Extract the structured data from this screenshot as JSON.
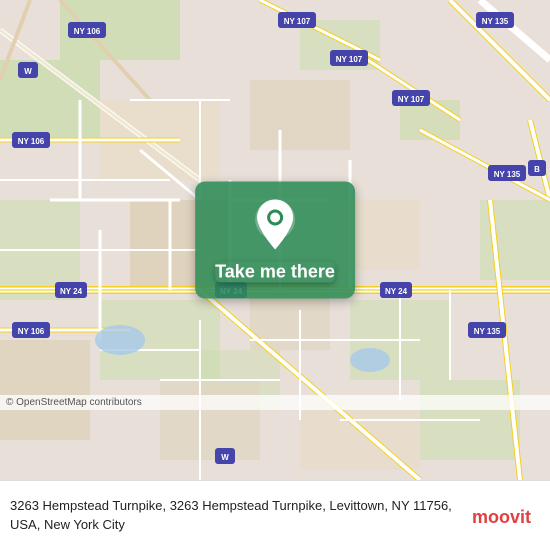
{
  "map": {
    "background_color": "#e8e0d8",
    "copyright": "© OpenStreetMap contributors",
    "location_pin_color": "#2e8b57",
    "roads": {
      "highway_color": "#f5d020",
      "street_color": "#ffffff",
      "major_road_color": "#ffd966"
    }
  },
  "button": {
    "label": "Take me there",
    "background_color": "#2e8b57",
    "text_color": "#ffffff"
  },
  "info_bar": {
    "address": "3263 Hempstead Turnpike, 3263 Hempstead Turnpike, Levittown, NY 11756, USA, New York City",
    "logo_text": "moovit",
    "logo_color": "#e04040"
  },
  "route_badges": [
    "NY 106",
    "NY 106",
    "NY 106",
    "NY 107",
    "NY 107",
    "NY 107",
    "NY 135",
    "NY 135",
    "NY 135",
    "NY 24",
    "NY 24",
    "NY 24",
    "W",
    "W",
    "B"
  ]
}
